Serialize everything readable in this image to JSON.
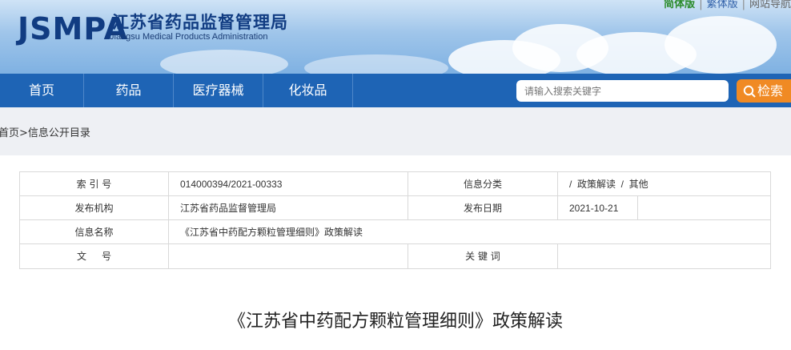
{
  "header": {
    "logo_mark": "JSMPA",
    "org_name_cn": "江苏省药品监督管理局",
    "org_name_en": "Jiangsu Medical Products Administration",
    "top_links": [
      "简体版",
      "繁体版",
      "网站导航"
    ]
  },
  "nav": {
    "items": [
      "首页",
      "药品",
      "医疗器械",
      "化妆品"
    ],
    "search_placeholder": "请输入搜索关键字",
    "search_button": "检索"
  },
  "breadcrumb": "首页>信息公开目录",
  "info_table": {
    "index_label": "索 引 号",
    "index_value": "014000394/2021-00333",
    "category_label": "信息分类",
    "category_value": "/  政策解读  /  其他",
    "publisher_label": "发布机构",
    "publisher_value": "江苏省药品监督管理局",
    "date_label": "发布日期",
    "date_value": "2021-10-21",
    "name_label": "信息名称",
    "name_value": "《江苏省中药配方颗粒管理细则》政策解读",
    "doc_no_label": "文     号",
    "doc_no_value": "",
    "keywords_label": "关 键 词",
    "keywords_value": ""
  },
  "article": {
    "title": "《江苏省中药配方颗粒管理细则》政策解读"
  },
  "colors": {
    "nav_bg": "#1e64b5",
    "search_button_bg": "#f08a24",
    "logo_color": "#113c82"
  }
}
